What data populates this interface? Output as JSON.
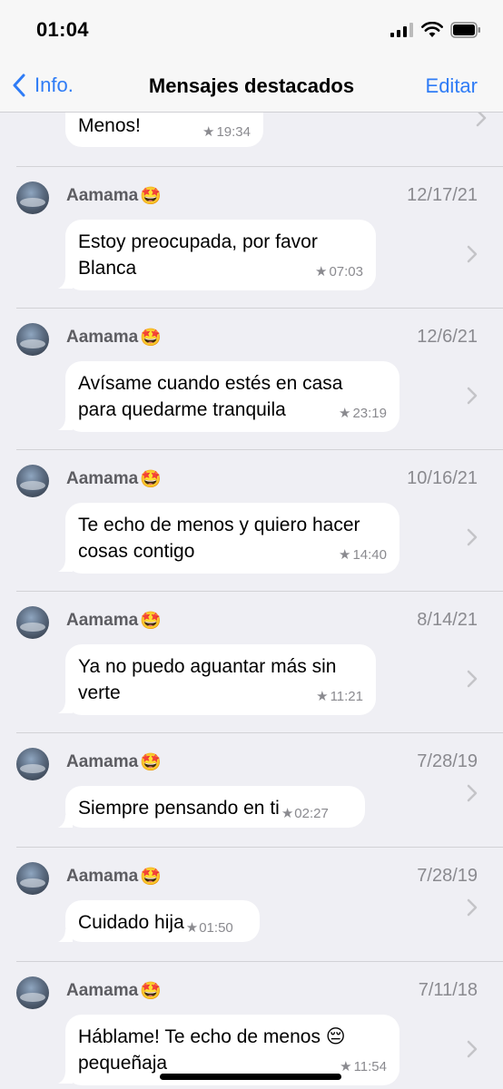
{
  "status_bar": {
    "time": "01:04"
  },
  "nav": {
    "back_label": "Info.",
    "title": "Mensajes destacados",
    "edit_label": "Editar"
  },
  "first_message": {
    "text": "Menos!",
    "time": "19:34"
  },
  "messages": [
    {
      "sender": "Aamama",
      "date": "12/17/21",
      "text": "Estoy preocupada, por favor Blanca",
      "time": "07:03"
    },
    {
      "sender": "Aamama",
      "date": "12/6/21",
      "text": "Avísame cuando estés en casa para quedarme tranquila",
      "time": "23:19"
    },
    {
      "sender": "Aamama",
      "date": "10/16/21",
      "text": "Te echo de menos y quiero hacer cosas contigo",
      "time": "14:40"
    },
    {
      "sender": "Aamama",
      "date": "8/14/21",
      "text": "Ya no puedo aguantar más sin verte",
      "time": "11:21"
    },
    {
      "sender": "Aamama",
      "date": "7/28/19",
      "text": "Siempre pensando en ti",
      "time": "02:27"
    },
    {
      "sender": "Aamama",
      "date": "7/28/19",
      "text": "Cuidado hija",
      "time": "01:50"
    },
    {
      "sender": "Aamama",
      "date": "7/11/18",
      "text": "Háblame! Te echo de menos 😔 pequeñaja",
      "time": "11:54"
    }
  ],
  "icons": {
    "back": "chevron-left-icon",
    "chevron": "chevron-right-icon",
    "star": "star-icon",
    "sender_emoji": "star-struck-emoji-icon",
    "signal": "cellular-signal-icon",
    "wifi": "wifi-icon",
    "battery": "battery-icon"
  },
  "colors": {
    "accent": "#2f7cf6",
    "background": "#efeff4",
    "bubble": "#ffffff",
    "secondary_text": "#8a8a8f"
  }
}
